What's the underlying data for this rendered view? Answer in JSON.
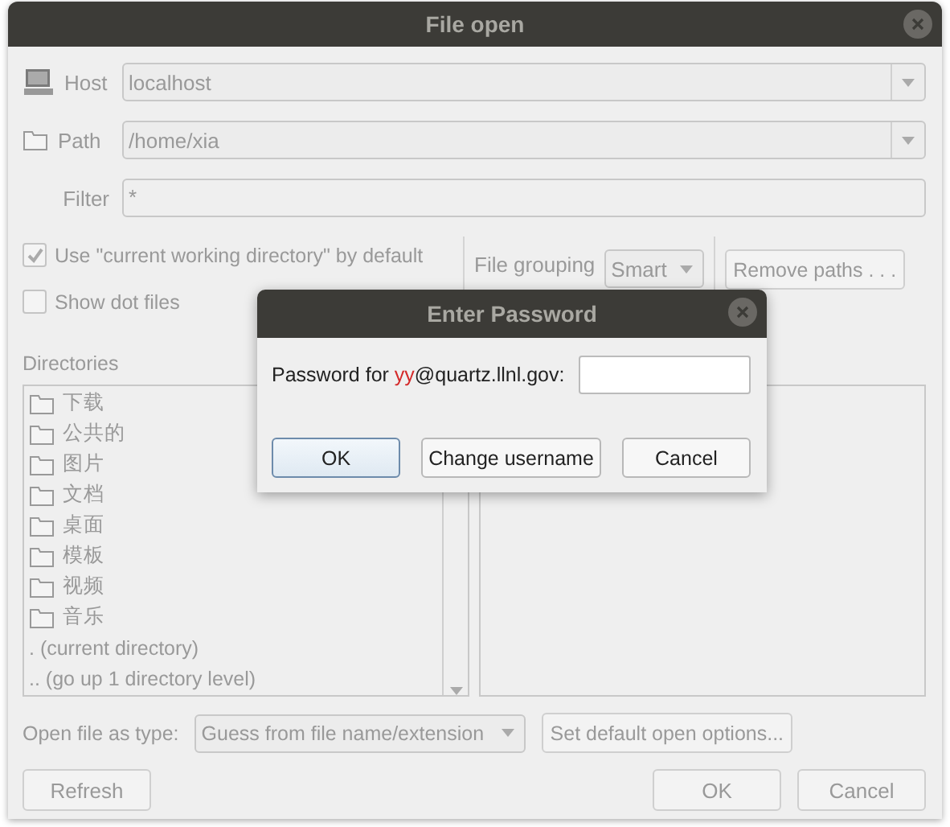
{
  "window": {
    "title": "File open",
    "disabled": true
  },
  "host": {
    "label": "Host",
    "value": "localhost"
  },
  "path": {
    "label": "Path",
    "value": "/home/xia"
  },
  "filter": {
    "label": "Filter",
    "value": "*"
  },
  "options": [
    {
      "label": "Use \"current working directory\" by default",
      "checked": true
    },
    {
      "label": "Show dot files",
      "checked": false
    }
  ],
  "file_grouping": {
    "label": "File grouping",
    "value": "Smart"
  },
  "remove_paths_button": "Remove paths . . .",
  "directories": {
    "label": "Directories",
    "items": [
      {
        "name": "下载",
        "kind": "folder"
      },
      {
        "name": "公共的",
        "kind": "folder"
      },
      {
        "name": "图片",
        "kind": "folder"
      },
      {
        "name": "文档",
        "kind": "folder"
      },
      {
        "name": "桌面",
        "kind": "folder"
      },
      {
        "name": "模板",
        "kind": "folder"
      },
      {
        "name": "视频",
        "kind": "folder"
      },
      {
        "name": "音乐",
        "kind": "folder"
      },
      {
        "name": ". (current directory)",
        "kind": "entry"
      },
      {
        "name": ".. (go up 1 directory level)",
        "kind": "entry"
      }
    ]
  },
  "open_as": {
    "label": "Open file as type:",
    "value": "Guess from file name/extension"
  },
  "set_default_button": "Set default open options...",
  "buttons": {
    "refresh": "Refresh",
    "ok": "OK",
    "cancel": "Cancel"
  },
  "dialog": {
    "title": "Enter Password",
    "prompt_prefix": "Password for ",
    "user": "yy",
    "host": "@quartz.llnl.gov:",
    "buttons": [
      {
        "label": "OK",
        "default": true
      },
      {
        "label": "Change username",
        "default": false
      },
      {
        "label": "Cancel",
        "default": false
      }
    ]
  }
}
